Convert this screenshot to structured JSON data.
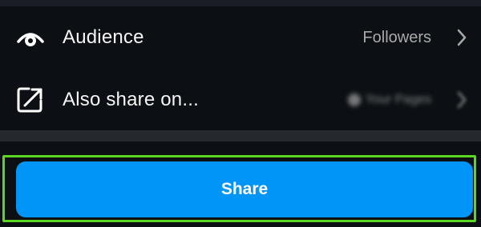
{
  "settings": {
    "audience": {
      "label": "Audience",
      "value": "Followers",
      "icon": "eye-icon"
    },
    "also_share": {
      "label": "Also share on...",
      "icon": "share-external-icon",
      "account_value": "Your Pages"
    }
  },
  "actions": {
    "share_label": "Share"
  },
  "colors": {
    "background": "#0c1014",
    "primary_button": "#0095f6",
    "highlight_border": "#5bd722",
    "secondary_text": "#a8a8a8"
  }
}
